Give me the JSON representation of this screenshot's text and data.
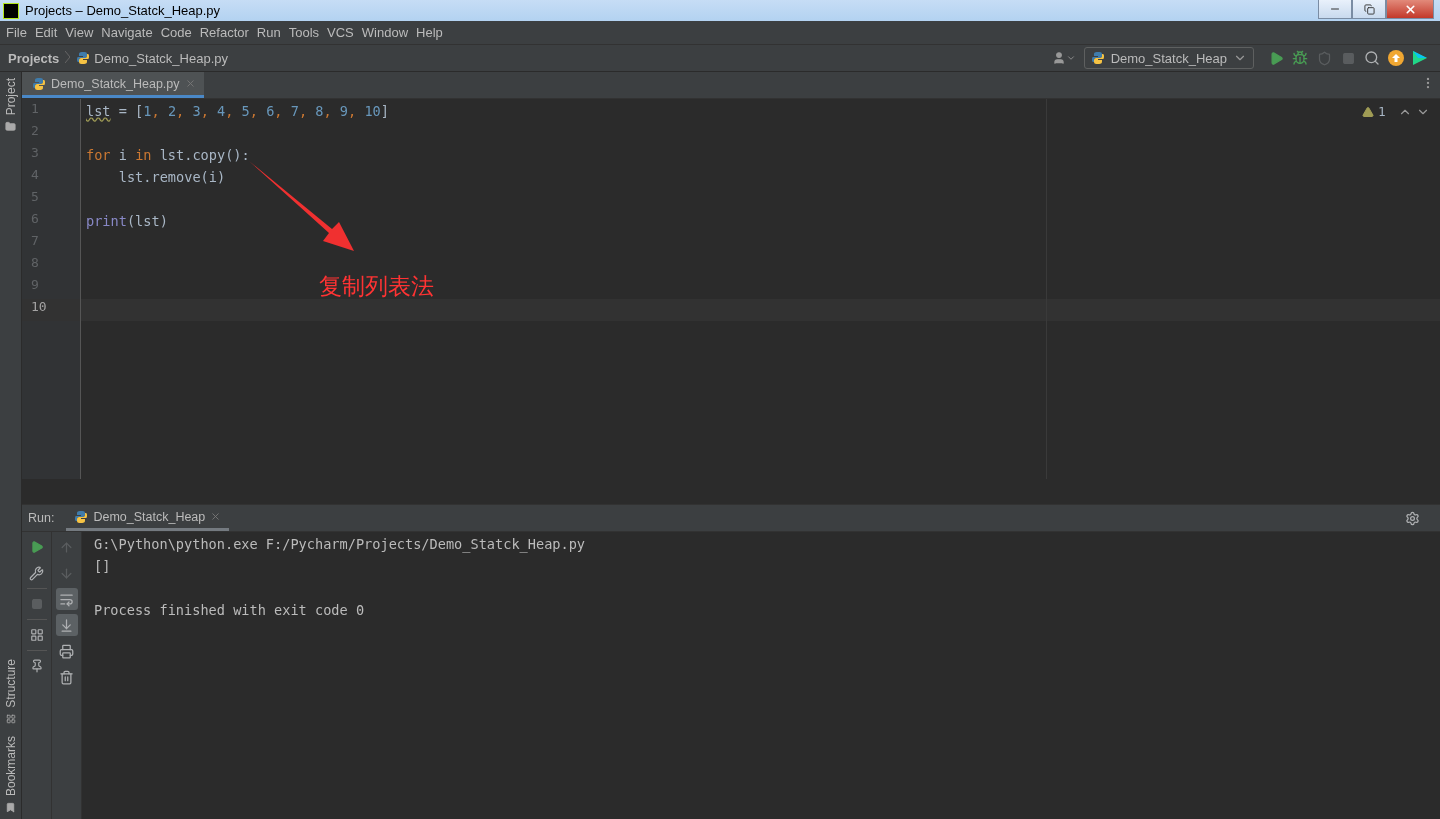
{
  "window": {
    "title": "Projects – Demo_Statck_Heap.py"
  },
  "menu": [
    "File",
    "Edit",
    "View",
    "Navigate",
    "Code",
    "Refactor",
    "Run",
    "Tools",
    "VCS",
    "Window",
    "Help"
  ],
  "breadcrumbs": [
    "Projects",
    "Demo_Statck_Heap.py"
  ],
  "toolbar": {
    "run_config": "Demo_Statck_Heap",
    "actions": [
      {
        "kind": "run",
        "disabled": false
      },
      {
        "kind": "debug",
        "disabled": false
      },
      {
        "kind": "coverage",
        "disabled": true
      },
      {
        "kind": "stop",
        "disabled": true
      },
      {
        "kind": "search",
        "disabled": false
      },
      {
        "kind": "update",
        "disabled": false
      },
      {
        "kind": "toolbox",
        "disabled": false
      }
    ]
  },
  "side_tabs_top": [
    "Project"
  ],
  "side_tabs_bottom": [
    "Structure",
    "Bookmarks"
  ],
  "editor": {
    "tabs": [
      {
        "label": "Demo_Statck_Heap.py",
        "selected": true
      }
    ],
    "warnings": "1",
    "lines": [
      {
        "number": "1",
        "current": false,
        "tokens": [
          {
            "kind": "warned",
            "text": "lst"
          },
          {
            "kind": "name",
            "text": " = ["
          },
          {
            "kind": "number",
            "text": "1"
          },
          {
            "kind": "comma",
            "text": ", "
          },
          {
            "kind": "number",
            "text": "2"
          },
          {
            "kind": "comma",
            "text": ", "
          },
          {
            "kind": "number",
            "text": "3"
          },
          {
            "kind": "comma",
            "text": ", "
          },
          {
            "kind": "number",
            "text": "4"
          },
          {
            "kind": "comma",
            "text": ", "
          },
          {
            "kind": "number",
            "text": "5"
          },
          {
            "kind": "comma",
            "text": ", "
          },
          {
            "kind": "number",
            "text": "6"
          },
          {
            "kind": "comma",
            "text": ", "
          },
          {
            "kind": "number",
            "text": "7"
          },
          {
            "kind": "comma",
            "text": ", "
          },
          {
            "kind": "number",
            "text": "8"
          },
          {
            "kind": "comma",
            "text": ", "
          },
          {
            "kind": "number",
            "text": "9"
          },
          {
            "kind": "comma",
            "text": ", "
          },
          {
            "kind": "number",
            "text": "10"
          },
          {
            "kind": "name",
            "text": "]"
          }
        ]
      },
      {
        "number": "2",
        "current": false
      },
      {
        "number": "3",
        "current": false,
        "tokens": [
          {
            "kind": "keyword",
            "text": "for"
          },
          {
            "kind": "name",
            "text": " i "
          },
          {
            "kind": "keyword",
            "text": "in"
          },
          {
            "kind": "name",
            "text": " lst.copy():"
          }
        ]
      },
      {
        "number": "4",
        "current": false,
        "tokens": [
          {
            "kind": "name",
            "text": "    lst.remove(i)"
          }
        ]
      },
      {
        "number": "5",
        "current": false
      },
      {
        "number": "6",
        "current": false,
        "tokens": [
          {
            "kind": "builtin",
            "text": "print"
          },
          {
            "kind": "name",
            "text": "(lst)"
          }
        ]
      },
      {
        "number": "7",
        "current": false
      },
      {
        "number": "8",
        "current": false
      },
      {
        "number": "9",
        "current": false
      },
      {
        "number": "10",
        "current": true
      }
    ]
  },
  "annotation": {
    "text": "复制列表法"
  },
  "run": {
    "label": "Run:",
    "tabs": [
      {
        "label": "Demo_Statck_Heap",
        "selected": true
      }
    ],
    "tools_left": [
      {
        "kind": "rerun",
        "disabled": false
      },
      {
        "kind": "settings",
        "disabled": false
      },
      {
        "kind": "stop",
        "disabled": true
      },
      {
        "kind": "layout",
        "disabled": false
      },
      {
        "kind": "pin",
        "disabled": false
      }
    ],
    "tools_right": [
      {
        "kind": "up",
        "disabled": true,
        "on": false
      },
      {
        "kind": "down",
        "disabled": true,
        "on": false
      },
      {
        "kind": "wrap",
        "disabled": false,
        "on": true
      },
      {
        "kind": "scroll",
        "disabled": false,
        "on": true
      },
      {
        "kind": "print",
        "disabled": false,
        "on": false
      },
      {
        "kind": "clear",
        "disabled": false,
        "on": false
      }
    ],
    "output": [
      [
        "G:\\Python\\python.exe F:/Pycharm/Projects/Demo_Statck_Heap.py",
        "[]"
      ],
      [
        "Process finished with exit code 0"
      ]
    ]
  }
}
